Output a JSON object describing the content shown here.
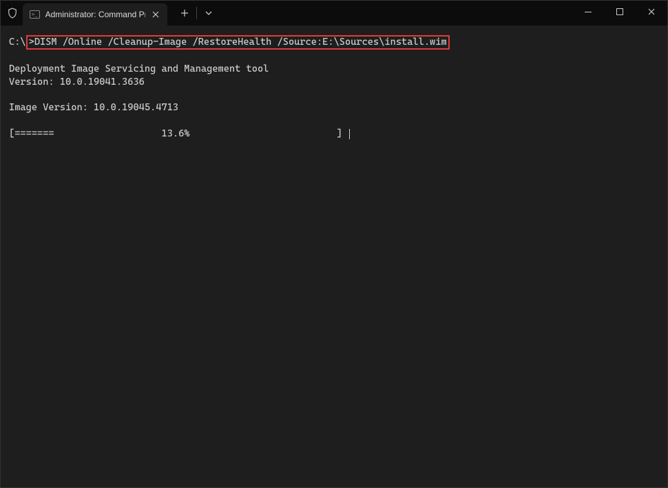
{
  "titlebar": {
    "tab_title": "Administrator: Command Prom",
    "tab_icon_text": ">_"
  },
  "terminal": {
    "prompt_prefix": "C:\\",
    "prompt_symbol": ">",
    "command": "DISM /Online /Cleanup-Image /RestoreHealth /Source:E:\\Sources\\install.wim",
    "tool_name": "Deployment Image Servicing and Management tool",
    "version_label": "Version: 10.0.19041.3636",
    "image_version_label": "Image Version: 10.0.19045.4713",
    "progress_open": "[",
    "progress_filled": "=======",
    "progress_spaces_before_pct": "                   ",
    "progress_percent": "13.6%",
    "progress_spaces_after_pct": "                          ",
    "progress_close": "]"
  }
}
